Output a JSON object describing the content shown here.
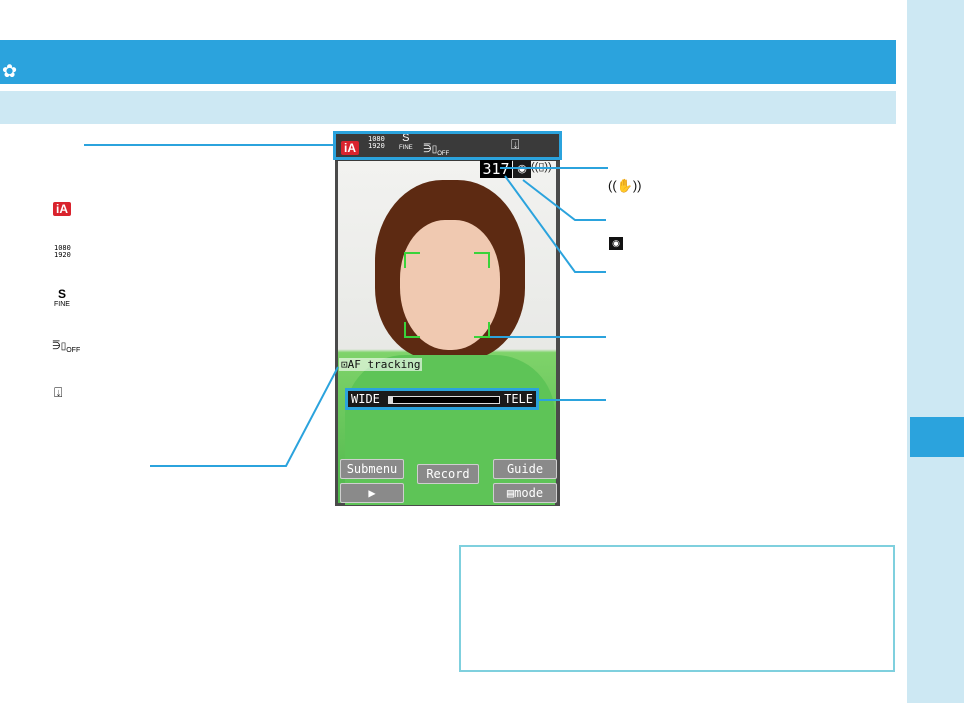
{
  "colors": {
    "accent": "#2ba3dd",
    "light": "#cde8f3",
    "focus": "#3ad33a",
    "ia_red": "#d9232d"
  },
  "title_bar": {
    "icon": "flower-icon"
  },
  "legend": [
    {
      "icon": "intelligent-auto-icon",
      "label": "iA"
    },
    {
      "icon": "resolution-icon",
      "top": "1080",
      "bottom": "1920"
    },
    {
      "icon": "quality-icon",
      "top": "S",
      "bottom": "FINE"
    },
    {
      "icon": "light-off-icon",
      "label": "OFF"
    },
    {
      "icon": "memory-icon"
    }
  ],
  "status_bar": {
    "mode": "iA",
    "res_top": "1080",
    "res_bottom": "1920",
    "quality_top": "S",
    "quality_bottom": "FINE",
    "light": "OFF"
  },
  "viewfinder": {
    "count": "317",
    "af_label": "AF tracking",
    "zoom_wide": "WIDE",
    "zoom_tele": "TELE",
    "zoom_level": 0.02
  },
  "softkeys": {
    "submenu": "Submenu",
    "record": "Record",
    "guide": "Guide",
    "play": "▶",
    "mode": "mode"
  }
}
